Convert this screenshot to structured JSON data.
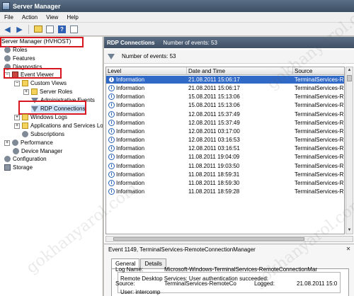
{
  "window": {
    "title": "Server Manager"
  },
  "menu": [
    "File",
    "Action",
    "View",
    "Help"
  ],
  "toolbar": {
    "icons": [
      "back-arrow-icon",
      "forward-arrow-icon",
      "up-folder-icon",
      "show-hide-tree-icon",
      "help-icon",
      "properties-icon"
    ]
  },
  "tree": {
    "items": [
      {
        "label": "Server Manager (HVHOST)",
        "indent": 0,
        "icon": "server-icon"
      },
      {
        "label": "Roles",
        "indent": 1,
        "icon": "roles-icon"
      },
      {
        "label": "Features",
        "indent": 1,
        "icon": "features-icon"
      },
      {
        "label": "Diagnostics",
        "indent": 1,
        "icon": "diagnostics-icon"
      },
      {
        "label": "Event Viewer",
        "indent": 2,
        "icon": "event-viewer-icon"
      },
      {
        "label": "Custom Views",
        "indent": 3,
        "icon": "folder-icon"
      },
      {
        "label": "Server Roles",
        "indent": 4,
        "icon": "folder-icon"
      },
      {
        "label": "Administrative Events",
        "indent": 4,
        "icon": "filter-icon"
      },
      {
        "label": "RDP Connections",
        "indent": 4,
        "icon": "filter-icon"
      },
      {
        "label": "Windows Logs",
        "indent": 3,
        "icon": "folder-icon"
      },
      {
        "label": "Applications and Services Lo",
        "indent": 3,
        "icon": "folder-icon"
      },
      {
        "label": "Subscriptions",
        "indent": 3,
        "icon": "subscriptions-icon"
      },
      {
        "label": "Performance",
        "indent": 2,
        "icon": "performance-icon"
      },
      {
        "label": "Device Manager",
        "indent": 2,
        "icon": "device-manager-icon"
      },
      {
        "label": "Configuration",
        "indent": 1,
        "icon": "configuration-icon"
      },
      {
        "label": "Storage",
        "indent": 1,
        "icon": "storage-icon"
      }
    ]
  },
  "panel": {
    "title": "RDP Connections",
    "count_label": "Number of events: 53"
  },
  "filter": {
    "label": "Number of events: 53"
  },
  "grid": {
    "columns": [
      "Level",
      "Date and Time",
      "Source"
    ],
    "rows": [
      [
        "Information",
        "21.08.2011 15:06:17",
        "TerminalServices-R"
      ],
      [
        "Information",
        "21.08.2011 15:06:17",
        "TerminalServices-R"
      ],
      [
        "Information",
        "15.08.2011 15:13:06",
        "TerminalServices-R"
      ],
      [
        "Information",
        "15.08.2011 15:13:06",
        "TerminalServices-R"
      ],
      [
        "Information",
        "12.08.2011 15:37:49",
        "TerminalServices-R"
      ],
      [
        "Information",
        "12.08.2011 15:37:49",
        "TerminalServices-R"
      ],
      [
        "Information",
        "12.08.2011 03:17:00",
        "TerminalServices-R"
      ],
      [
        "Information",
        "12.08.2011 03:16:53",
        "TerminalServices-R"
      ],
      [
        "Information",
        "12.08.2011 03:16:51",
        "TerminalServices-R"
      ],
      [
        "Information",
        "11.08.2011 19:04:09",
        "TerminalServices-R"
      ],
      [
        "Information",
        "11.08.2011 19:03:50",
        "TerminalServices-R"
      ],
      [
        "Information",
        "11.08.2011 18:59:31",
        "TerminalServices-R"
      ],
      [
        "Information",
        "11.08.2011 18:59:30",
        "TerminalServices-R"
      ],
      [
        "Information",
        "11.08.2011 18:59:28",
        "TerminalServices-R"
      ]
    ]
  },
  "detail": {
    "title": "Event 1149, TerminalServices-RemoteConnectionManager",
    "tabs": [
      "General",
      "Details"
    ],
    "message_line1": "Remote Desktop Services: User authentication succeeded:",
    "message_line2": "User: intercomp",
    "log_name_label": "Log Name:",
    "log_name_value": "Microsoft-Windows-TerminalServices-RemoteConnectionMar",
    "source_label": "Source:",
    "source_value": "TerminalServices-RemoteCo",
    "logged_label": "Logged:",
    "logged_value": "21.08.2011 15:0"
  },
  "watermark": "gokhanyarol.com",
  "colors": {
    "highlight_box": "#d6171f",
    "selection": "#3169c6",
    "header": "#3f5066"
  }
}
